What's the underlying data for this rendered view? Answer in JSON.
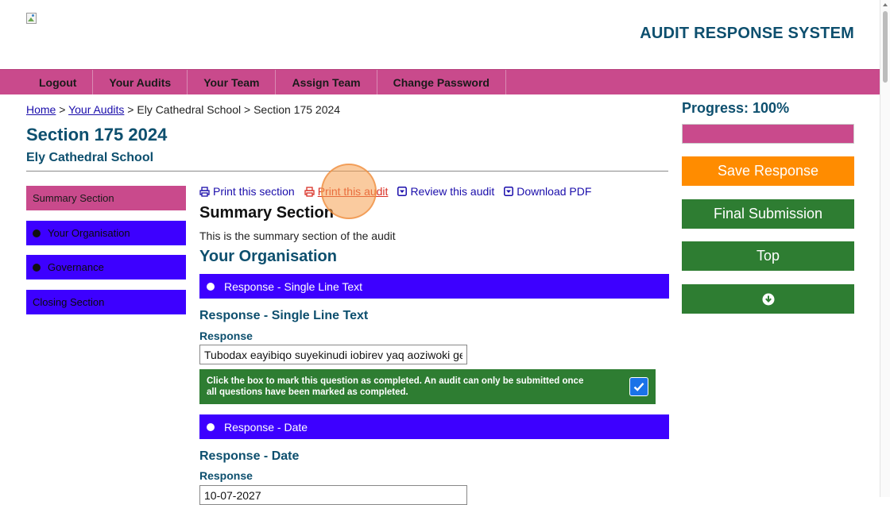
{
  "header": {
    "system_title": "AUDIT RESPONSE SYSTEM",
    "logo": "broken-image-icon"
  },
  "nav": {
    "items": [
      "Logout",
      "Your Audits",
      "Your Team",
      "Assign Team",
      "Change Password"
    ]
  },
  "breadcrumb": {
    "home": "Home",
    "sep1": " > ",
    "audits": "Your Audits",
    "sep2": " > ",
    "school": "Ely Cathedral School",
    "sep3": " > ",
    "section": "Section 175 2024"
  },
  "page": {
    "title": "Section 175 2024",
    "school": "Ely Cathedral School"
  },
  "sidebar": {
    "items": [
      {
        "label": "Summary Section"
      },
      {
        "label": "Your Organisation"
      },
      {
        "label": "Governance"
      },
      {
        "label": "Closing Section"
      }
    ]
  },
  "actions": {
    "print_section": "Print this section",
    "print_audit": "Print this audit",
    "review": "Review this audit",
    "download": "Download PDF"
  },
  "content": {
    "summary_heading": "Summary Section",
    "summary_desc": "This is the summary section of the audit",
    "org_heading": "Your Organisation"
  },
  "questions": [
    {
      "bar_label": "Response - Single Line Text",
      "title": "Response - Single Line Text",
      "label": "Response",
      "value": "Tubodax eayibiqo suyekinudi iobirev yaq aoziwoki geba i",
      "completion_text": "Click the box to mark this question as completed. An audit can only be submitted once all questions have been marked as completed.",
      "completed": true
    },
    {
      "bar_label": "Response - Date",
      "title": "Response - Date",
      "label": "Response",
      "value": "10-07-2027"
    }
  ],
  "progress": {
    "label": "Progress: 100%",
    "percent": 100,
    "color": "#c94a8c"
  },
  "right_buttons": {
    "save": "Save Response",
    "final": "Final Submission",
    "top": "Top",
    "down_icon": "arrow-down-circle-icon"
  },
  "colors": {
    "brand_pink": "#c94a8c",
    "nav_blue": "#3d00ff",
    "heading_teal": "#0d4f6e",
    "green": "#2e7d32",
    "orange": "#ff8c00"
  }
}
